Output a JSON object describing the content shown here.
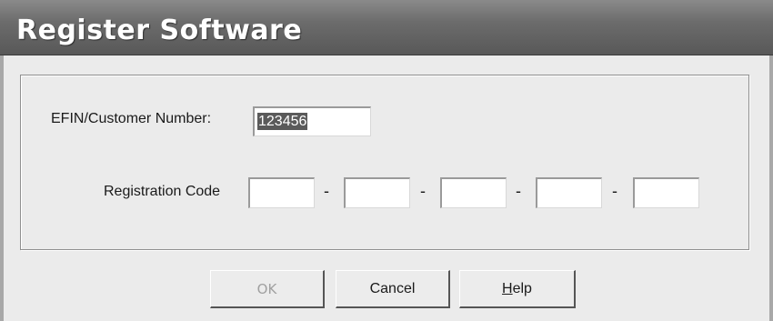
{
  "window": {
    "title": "Register Software"
  },
  "form": {
    "efin_label": "EFIN/Customer Number:",
    "efin_value": "123456",
    "registration_label": "Registration Code",
    "registration_fields": [
      "",
      "",
      "",
      "",
      ""
    ],
    "separator": "-"
  },
  "buttons": {
    "ok_label": "OK",
    "ok_enabled": false,
    "cancel_label": "Cancel",
    "help_label": "Help",
    "help_mnemonic": "H"
  }
}
